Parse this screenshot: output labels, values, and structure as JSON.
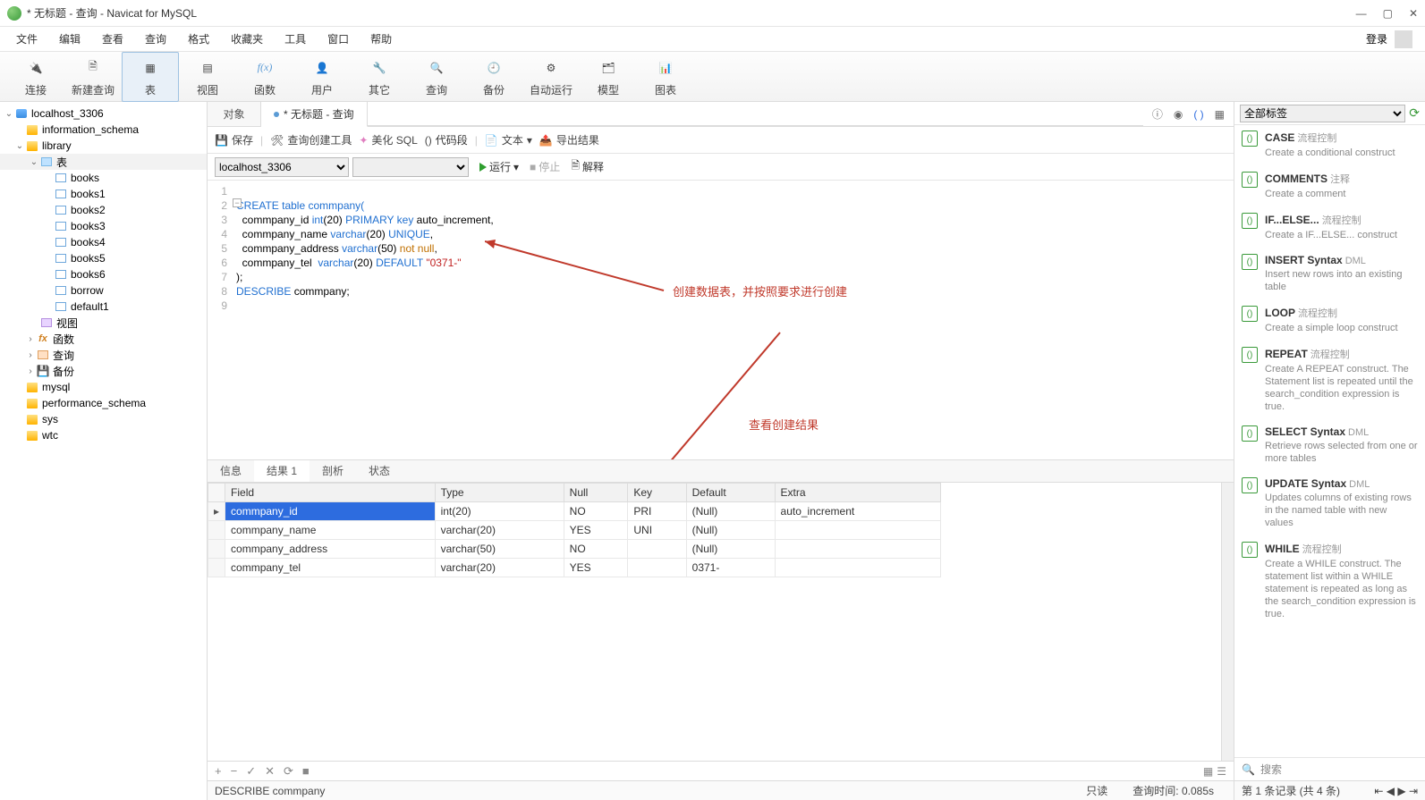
{
  "window": {
    "title": "* 无标题 - 查询 - Navicat for MySQL"
  },
  "menu": [
    "文件",
    "编辑",
    "查看",
    "查询",
    "格式",
    "收藏夹",
    "工具",
    "窗口",
    "帮助"
  ],
  "menu_right": {
    "login": "登录"
  },
  "toolbar": [
    {
      "id": "connect",
      "label": "连接"
    },
    {
      "id": "newquery",
      "label": "新建查询"
    },
    {
      "id": "table",
      "label": "表",
      "active": true
    },
    {
      "id": "view",
      "label": "视图"
    },
    {
      "id": "function",
      "label": "函数"
    },
    {
      "id": "user",
      "label": "用户"
    },
    {
      "id": "other",
      "label": "其它"
    },
    {
      "id": "query",
      "label": "查询"
    },
    {
      "id": "backup",
      "label": "备份"
    },
    {
      "id": "autorun",
      "label": "自动运行"
    },
    {
      "id": "model",
      "label": "模型"
    },
    {
      "id": "chart",
      "label": "图表"
    }
  ],
  "conn": {
    "root": "localhost_3306"
  },
  "tree": {
    "information_schema": "information_schema",
    "library": "library",
    "tables_label": "表",
    "tables": [
      "books",
      "books1",
      "books2",
      "books3",
      "books4",
      "books5",
      "books6",
      "borrow",
      "default1"
    ],
    "view": "视图",
    "func": "函数",
    "query": "查询",
    "backup": "备份",
    "dbs": [
      "mysql",
      "performance_schema",
      "sys",
      "wtc"
    ]
  },
  "tabs": {
    "objects": "对象",
    "query": "* 无标题 - 查询"
  },
  "qbar": {
    "save": "保存",
    "builder": "查询创建工具",
    "beautify": "美化 SQL",
    "snippet": "代码段",
    "text": "文本",
    "export": "导出结果"
  },
  "connbar": {
    "conn": "localhost_3306",
    "run": "运行",
    "stop": "停止",
    "explain": "解释"
  },
  "code": {
    "l2": "CREATE table commpany(",
    "l3a": "commpany_id ",
    "l3b": "int",
    "l3c": "(20) ",
    "l3d": "PRIMARY key",
    "l3e": " auto_increment,",
    "l4a": "commpany_name ",
    "l4b": "varchar",
    "l4c": "(20) ",
    "l4d": "UNIQUE",
    "l4e": ",",
    "l5a": "commpany_address ",
    "l5b": "varchar",
    "l5c": "(50) ",
    "l5d": "not null",
    "l5e": ",",
    "l6a": "commpany_tel  ",
    "l6b": "varchar",
    "l6c": "(20) ",
    "l6d": "DEFAULT",
    "l6e": " \"0371-\"",
    "l7": ");",
    "l8a": "DESCRIBE",
    "l8b": " commpany;"
  },
  "annotations": {
    "a1": "创建数据表，并按照要求进行创建",
    "a2": "查看创建结果"
  },
  "restabs": [
    "信息",
    "结果 1",
    "剖析",
    "状态"
  ],
  "columns": [
    "Field",
    "Type",
    "Null",
    "Key",
    "Default",
    "Extra"
  ],
  "rows": [
    {
      "Field": "commpany_id",
      "Type": "int(20)",
      "Null": "NO",
      "Key": "PRI",
      "Default": "(Null)",
      "Extra": "auto_increment",
      "sel": true,
      "dnull": true
    },
    {
      "Field": "commpany_name",
      "Type": "varchar(20)",
      "Null": "YES",
      "Key": "UNI",
      "Default": "(Null)",
      "Extra": "",
      "dnull": true
    },
    {
      "Field": "commpany_address",
      "Type": "varchar(50)",
      "Null": "NO",
      "Key": "",
      "Default": "(Null)",
      "Extra": "",
      "dnull": true
    },
    {
      "Field": "commpany_tel",
      "Type": "varchar(20)",
      "Null": "YES",
      "Key": "",
      "Default": "0371-",
      "Extra": ""
    }
  ],
  "status": {
    "sql": "DESCRIBE commpany",
    "readonly": "只读",
    "qtime": "查询时间: 0.085s",
    "record": "第 1 条记录 (共 4 条)"
  },
  "rpanel": {
    "filter": "全部标签",
    "search_ph": "搜索",
    "items": [
      {
        "t": "CASE",
        "tag": "流程控制",
        "d": "Create a conditional construct"
      },
      {
        "t": "COMMENTS",
        "tag": "注释",
        "d": "Create a comment"
      },
      {
        "t": "IF...ELSE...",
        "tag": "流程控制",
        "d": "Create a IF...ELSE... construct"
      },
      {
        "t": "INSERT Syntax",
        "tag": "DML",
        "d": "Insert new rows into an existing table"
      },
      {
        "t": "LOOP",
        "tag": "流程控制",
        "d": "Create a simple loop construct"
      },
      {
        "t": "REPEAT",
        "tag": "流程控制",
        "d": "Create A REPEAT construct. The Statement list is repeated until the search_condition expression is true."
      },
      {
        "t": "SELECT Syntax",
        "tag": "DML",
        "d": "Retrieve rows selected from one or more tables"
      },
      {
        "t": "UPDATE Syntax",
        "tag": "DML",
        "d": "Updates columns of existing rows in the named table with new values"
      },
      {
        "t": "WHILE",
        "tag": "流程控制",
        "d": "Create a WHILE construct. The statement list within a WHILE statement is repeated as long as the search_condition expression is true."
      }
    ]
  }
}
